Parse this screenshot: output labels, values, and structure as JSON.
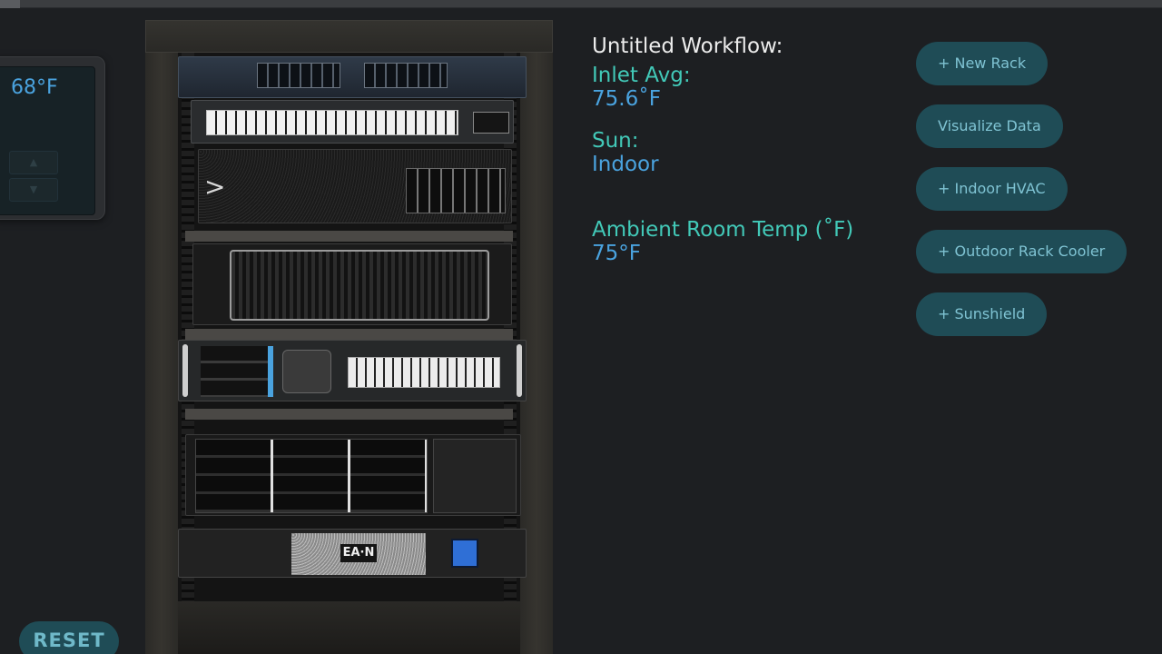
{
  "thermostat": {
    "temp": "68°F",
    "up_symbol": "▲",
    "down_symbol": "▼"
  },
  "reset_label": "RESET",
  "rack": {
    "switch_chevron": ">",
    "ups_brand": "EA·N"
  },
  "info": {
    "workflow_title": "Untitled Workflow:",
    "inlet_label": "Inlet Avg:",
    "inlet_value": "75.6˚F",
    "sun_label": "Sun:",
    "sun_value": "Indoor",
    "ambient_label": "Ambient Room Temp (˚F)",
    "ambient_value": "75°F"
  },
  "buttons": {
    "new_rack": "+ New Rack",
    "visualize": "Visualize Data",
    "indoor_hvac": "+ Indoor HVAC",
    "outdoor_cooler": "+ Outdoor Rack Cooler",
    "sunshield": "+ Sunshield"
  },
  "colors": {
    "background": "#1d1f22",
    "button_bg": "#1f4c56",
    "button_text": "#7fc3d3",
    "teal_label": "#42c9b8",
    "blue_value": "#4aa3df"
  }
}
